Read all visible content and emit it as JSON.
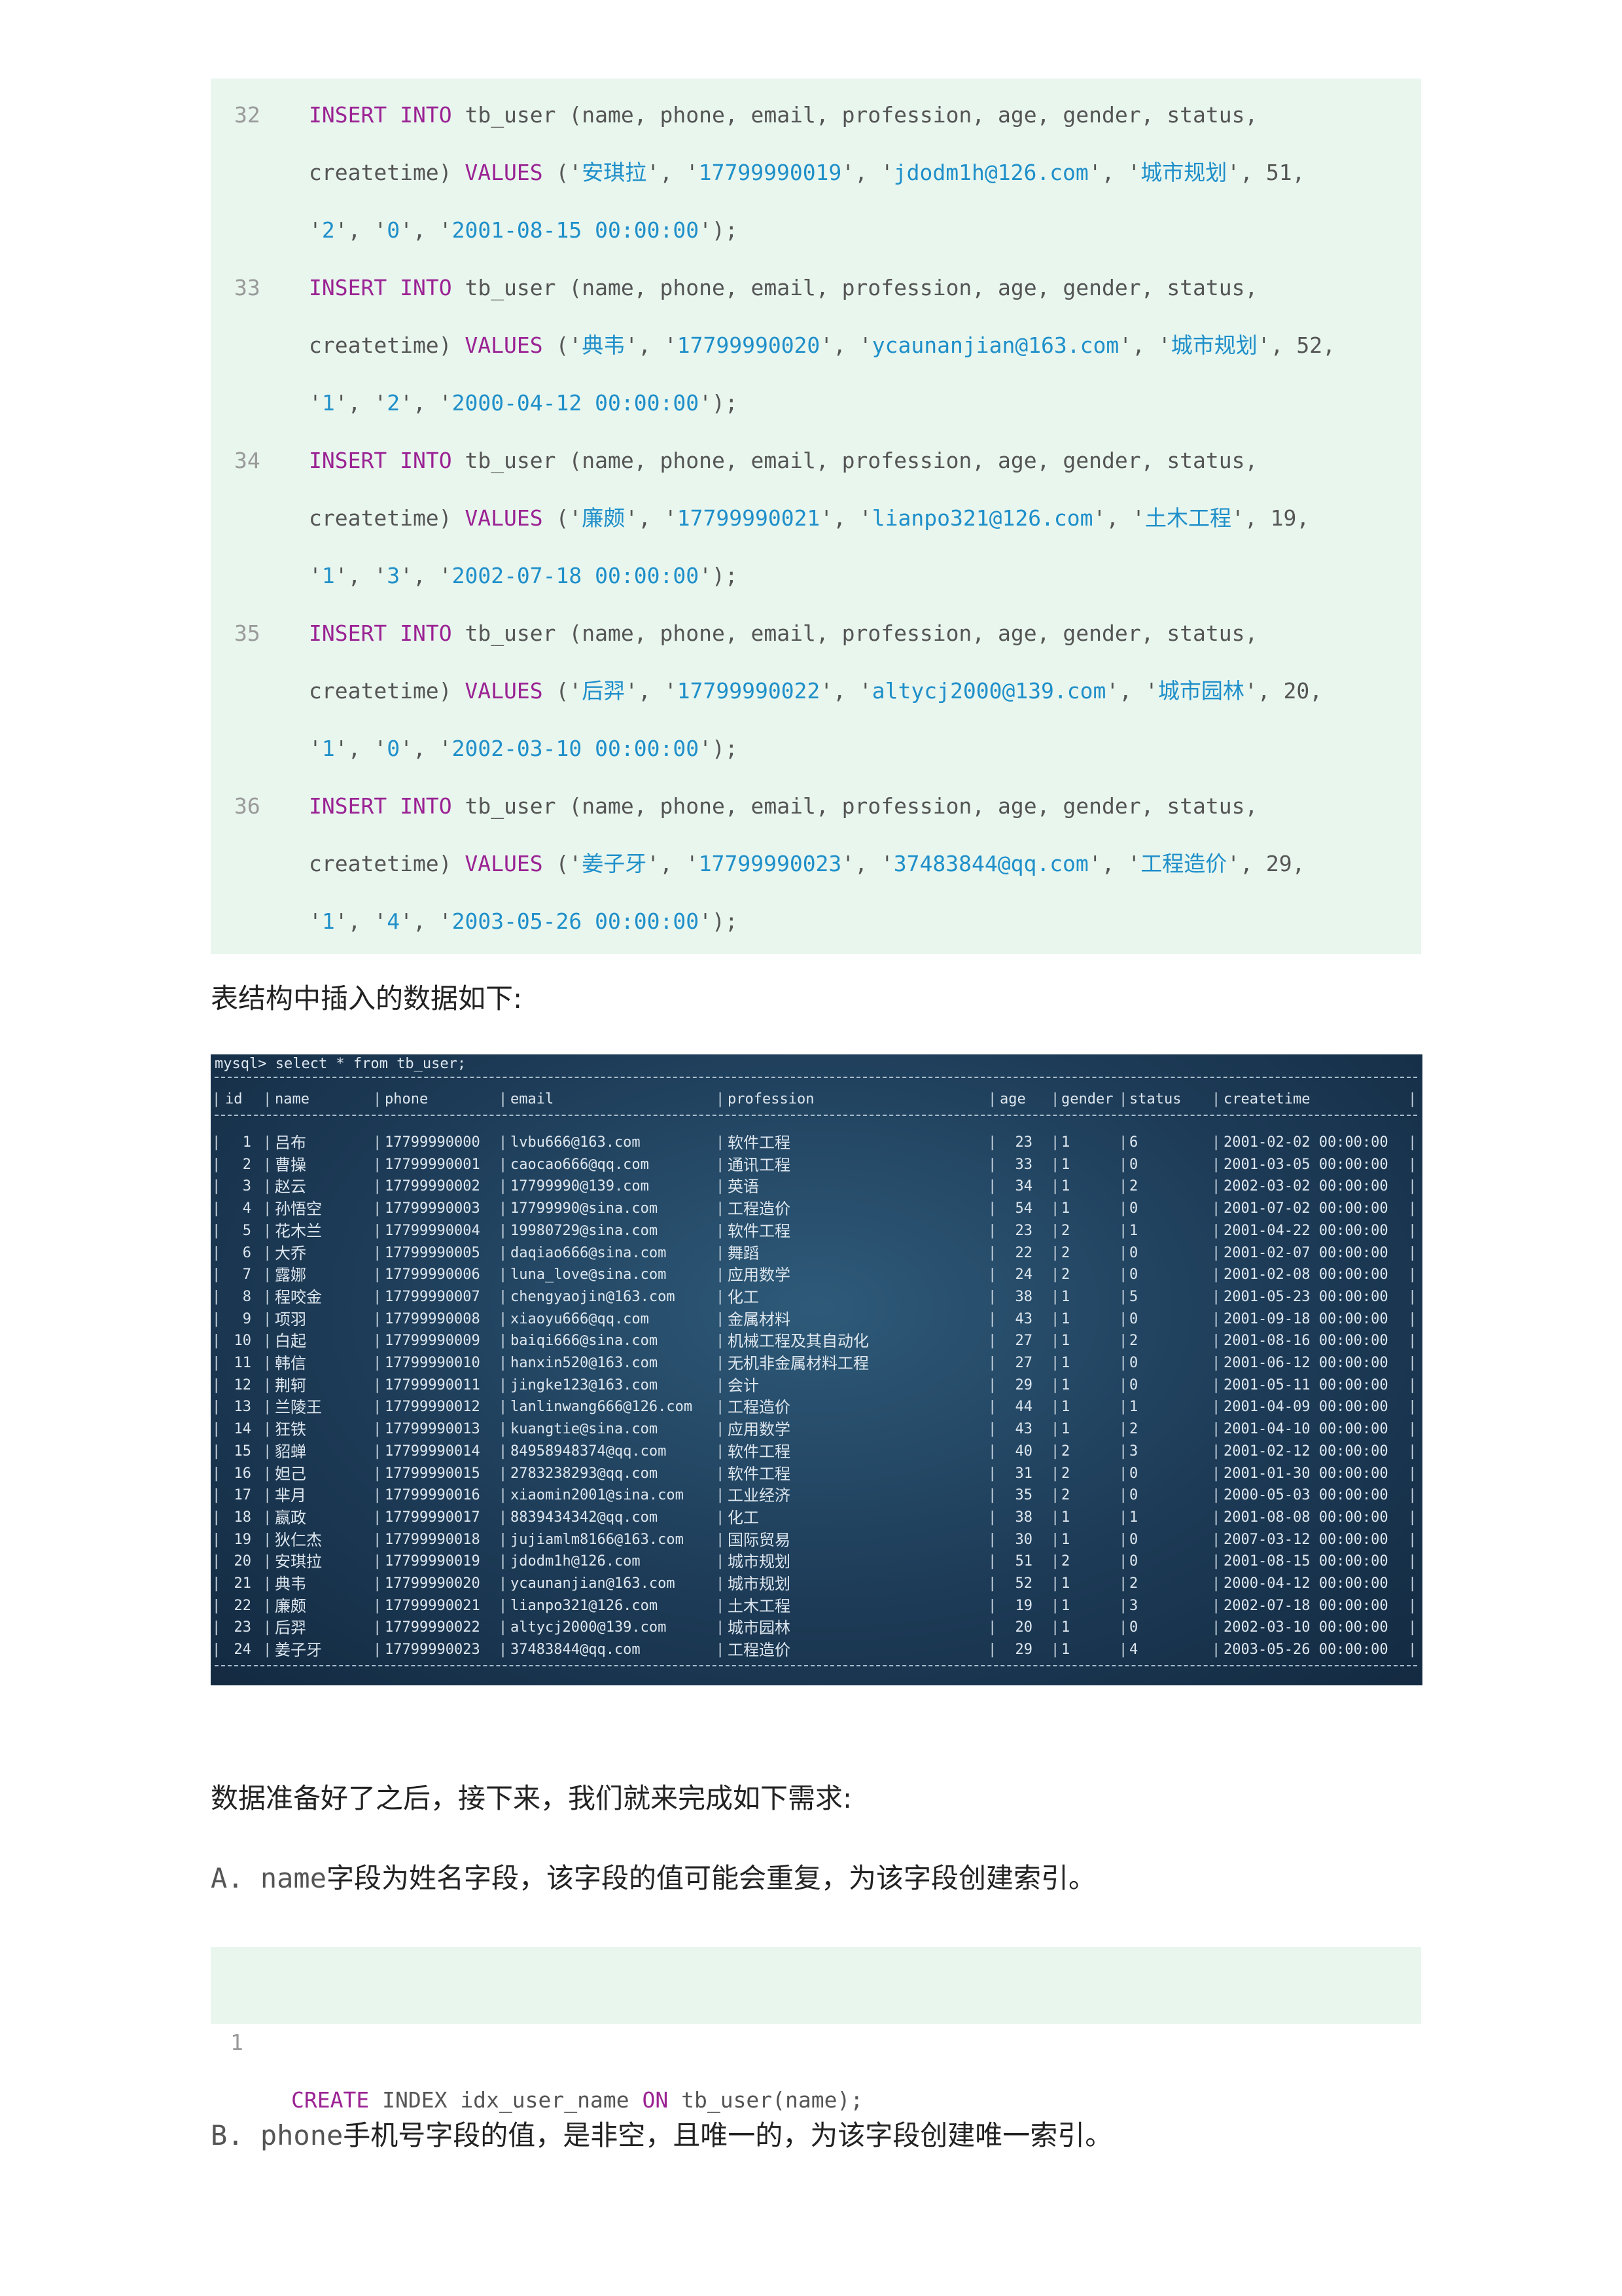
{
  "insert_statements": [
    {
      "line": "32",
      "name": "安琪拉",
      "phone": "17799990019",
      "email": "jdodm1h@126.com",
      "profession": "城市规划",
      "age": "51",
      "gender": "2",
      "status": "0",
      "createtime": "2001-08-15 00:00:00"
    },
    {
      "line": "33",
      "name": "典韦",
      "phone": "17799990020",
      "email": "ycaunanjian@163.com",
      "profession": "城市规划",
      "age": "52",
      "gender": "1",
      "status": "2",
      "createtime": "2000-04-12 00:00:00"
    },
    {
      "line": "34",
      "name": "廉颇",
      "phone": "17799990021",
      "email": "lianpo321@126.com",
      "profession": "土木工程",
      "age": "19",
      "gender": "1",
      "status": "3",
      "createtime": "2002-07-18 00:00:00"
    },
    {
      "line": "35",
      "name": "后羿",
      "phone": "17799990022",
      "email": "altycj2000@139.com",
      "profession": "城市园林",
      "age": "20",
      "gender": "1",
      "status": "0",
      "createtime": "2002-03-10 00:00:00"
    },
    {
      "line": "36",
      "name": "姜子牙",
      "phone": "17799990023",
      "email": "37483844@qq.com",
      "profession": "工程造价",
      "age": "29",
      "gender": "1",
      "status": "4",
      "createtime": "2003-05-26 00:00:00"
    }
  ],
  "sql": {
    "insert": "INSERT",
    "into": "INTO",
    "table": "tb_user",
    "columns_part1": "(name, phone, email, profession, age, gender, status,",
    "columns_part2": "createtime)",
    "values": "VALUES"
  },
  "caption_table": "表结构中插入的数据如下:",
  "terminal": {
    "prompt": "mysql> select * from tb_user;",
    "headers": [
      "id",
      "name",
      "phone",
      "email",
      "profession",
      "age",
      "gender",
      "status",
      "createtime"
    ],
    "rows": [
      [
        "1",
        "吕布",
        "17799990000",
        "lvbu666@163.com",
        "软件工程",
        "23",
        "1",
        "6",
        "2001-02-02 00:00:00"
      ],
      [
        "2",
        "曹操",
        "17799990001",
        "caocao666@qq.com",
        "通讯工程",
        "33",
        "1",
        "0",
        "2001-03-05 00:00:00"
      ],
      [
        "3",
        "赵云",
        "17799990002",
        "17799990@139.com",
        "英语",
        "34",
        "1",
        "2",
        "2002-03-02 00:00:00"
      ],
      [
        "4",
        "孙悟空",
        "17799990003",
        "17799990@sina.com",
        "工程造价",
        "54",
        "1",
        "0",
        "2001-07-02 00:00:00"
      ],
      [
        "5",
        "花木兰",
        "17799990004",
        "19980729@sina.com",
        "软件工程",
        "23",
        "2",
        "1",
        "2001-04-22 00:00:00"
      ],
      [
        "6",
        "大乔",
        "17799990005",
        "daqiao666@sina.com",
        "舞蹈",
        "22",
        "2",
        "0",
        "2001-02-07 00:00:00"
      ],
      [
        "7",
        "露娜",
        "17799990006",
        "luna_love@sina.com",
        "应用数学",
        "24",
        "2",
        "0",
        "2001-02-08 00:00:00"
      ],
      [
        "8",
        "程咬金",
        "17799990007",
        "chengyaojin@163.com",
        "化工",
        "38",
        "1",
        "5",
        "2001-05-23 00:00:00"
      ],
      [
        "9",
        "项羽",
        "17799990008",
        "xiaoyu666@qq.com",
        "金属材料",
        "43",
        "1",
        "0",
        "2001-09-18 00:00:00"
      ],
      [
        "10",
        "白起",
        "17799990009",
        "baiqi666@sina.com",
        "机械工程及其自动化",
        "27",
        "1",
        "2",
        "2001-08-16 00:00:00"
      ],
      [
        "11",
        "韩信",
        "17799990010",
        "hanxin520@163.com",
        "无机非金属材料工程",
        "27",
        "1",
        "0",
        "2001-06-12 00:00:00"
      ],
      [
        "12",
        "荆轲",
        "17799990011",
        "jingke123@163.com",
        "会计",
        "29",
        "1",
        "0",
        "2001-05-11 00:00:00"
      ],
      [
        "13",
        "兰陵王",
        "17799990012",
        "lanlinwang666@126.com",
        "工程造价",
        "44",
        "1",
        "1",
        "2001-04-09 00:00:00"
      ],
      [
        "14",
        "狂铁",
        "17799990013",
        "kuangtie@sina.com",
        "应用数学",
        "43",
        "1",
        "2",
        "2001-04-10 00:00:00"
      ],
      [
        "15",
        "貂蝉",
        "17799990014",
        "84958948374@qq.com",
        "软件工程",
        "40",
        "2",
        "3",
        "2001-02-12 00:00:00"
      ],
      [
        "16",
        "妲己",
        "17799990015",
        "2783238293@qq.com",
        "软件工程",
        "31",
        "2",
        "0",
        "2001-01-30 00:00:00"
      ],
      [
        "17",
        "芈月",
        "17799990016",
        "xiaomin2001@sina.com",
        "工业经济",
        "35",
        "2",
        "0",
        "2000-05-03 00:00:00"
      ],
      [
        "18",
        "嬴政",
        "17799990017",
        "8839434342@qq.com",
        "化工",
        "38",
        "1",
        "1",
        "2001-08-08 00:00:00"
      ],
      [
        "19",
        "狄仁杰",
        "17799990018",
        "jujiamlm8166@163.com",
        "国际贸易",
        "30",
        "1",
        "0",
        "2007-03-12 00:00:00"
      ],
      [
        "20",
        "安琪拉",
        "17799990019",
        "jdodm1h@126.com",
        "城市规划",
        "51",
        "2",
        "0",
        "2001-08-15 00:00:00"
      ],
      [
        "21",
        "典韦",
        "17799990020",
        "ycaunanjian@163.com",
        "城市规划",
        "52",
        "1",
        "2",
        "2000-04-12 00:00:00"
      ],
      [
        "22",
        "廉颇",
        "17799990021",
        "lianpo321@126.com",
        "土木工程",
        "19",
        "1",
        "3",
        "2002-07-18 00:00:00"
      ],
      [
        "23",
        "后羿",
        "17799990022",
        "altycj2000@139.com",
        "城市园林",
        "20",
        "1",
        "0",
        "2002-03-10 00:00:00"
      ],
      [
        "24",
        "姜子牙",
        "17799990023",
        "37483844@qq.com",
        "工程造价",
        "29",
        "1",
        "4",
        "2003-05-26 00:00:00"
      ]
    ]
  },
  "caption_requirements": "数据准备好了之后，接下来，我们就来完成如下需求:",
  "requirement_a": {
    "prefix": "A. ",
    "field": "name",
    "text": "字段为姓名字段，该字段的值可能会重复，为该字段创建索引。"
  },
  "code_index": {
    "line": "1",
    "create": "CREATE",
    "index": "INDEX",
    "index_name": "idx_user_name",
    "on": "ON",
    "target": "tb_user(name);"
  },
  "requirement_b": {
    "prefix": "B. ",
    "field": "phone",
    "text": "手机号字段的值，是非空，且唯一的，为该字段创建唯一索引。"
  }
}
